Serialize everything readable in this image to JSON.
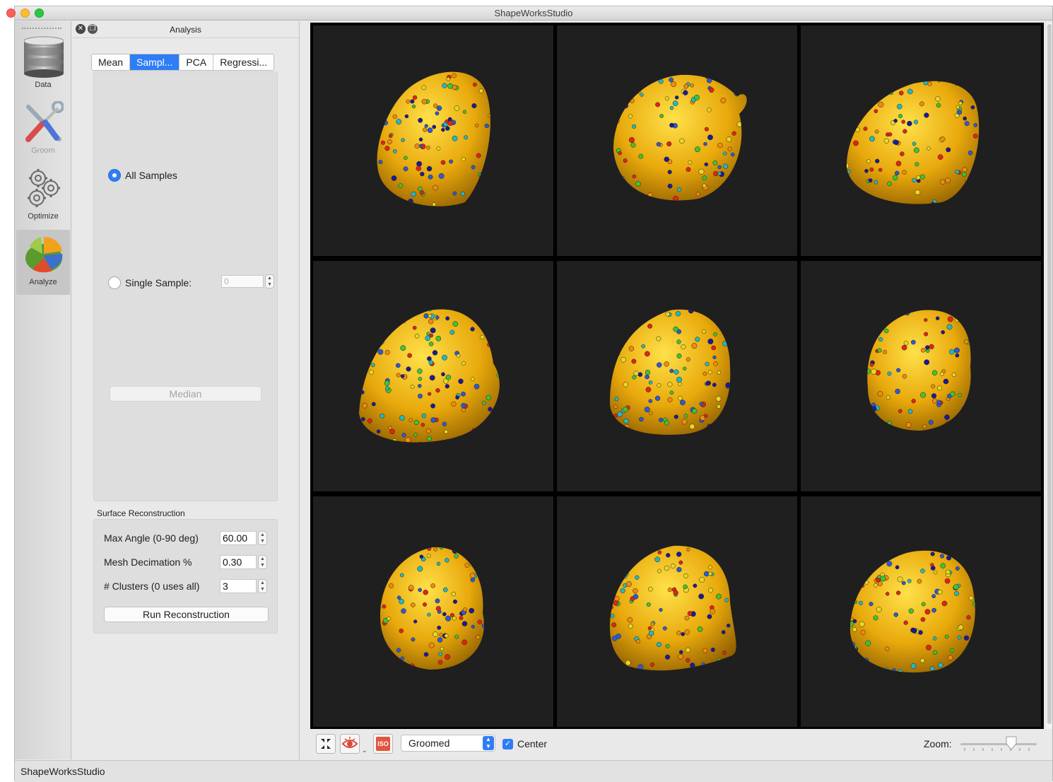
{
  "window": {
    "title": "ShapeWorksStudio"
  },
  "toolbar_left": {
    "tools": [
      {
        "label": "Data",
        "icon": "database-icon",
        "active": false,
        "disabled": false
      },
      {
        "label": "Groom",
        "icon": "tools-icon",
        "active": false,
        "disabled": true
      },
      {
        "label": "Optimize",
        "icon": "gears-icon",
        "active": false,
        "disabled": false
      },
      {
        "label": "Analyze",
        "icon": "pie-chart-icon",
        "active": true,
        "disabled": false
      }
    ]
  },
  "panel": {
    "title": "Analysis",
    "tabs": [
      {
        "label": "Mean",
        "active": false
      },
      {
        "label": "Sampl...",
        "active": true
      },
      {
        "label": "PCA",
        "active": false
      },
      {
        "label": "Regressi...",
        "active": false
      }
    ],
    "all_samples_label": "All Samples",
    "single_sample_label": "Single Sample:",
    "single_sample_value": "0",
    "median_label": "Median",
    "surface_reconstruction": {
      "title": "Surface Reconstruction",
      "max_angle_label": "Max Angle (0-90 deg)",
      "max_angle_value": "60.00",
      "mesh_decimation_label": "Mesh Decimation %",
      "mesh_decimation_value": "0.30",
      "clusters_label": "# Clusters (0 uses all)",
      "clusters_value": "3",
      "run_label": "Run Reconstruction"
    }
  },
  "viewer": {
    "grid": "3x3",
    "background": "#1f1f1f",
    "shape_color": "#e8a90c",
    "particle_colors": [
      "#e0241b",
      "#f08a14",
      "#e6d62a",
      "#3cc43a",
      "#21b8c8",
      "#2a5ad8",
      "#1a1a9a"
    ]
  },
  "bottom_toolbar": {
    "fit_icon": "fit-all-icon",
    "view_icon": "eye-view-icon",
    "iso_label": "ISO",
    "display_mode": "Groomed",
    "center_label": "Center",
    "zoom_label": "Zoom:",
    "zoom_level": 0.6
  },
  "status": {
    "text": "ShapeWorksStudio"
  },
  "colors": {
    "accent": "#2f7df6"
  }
}
